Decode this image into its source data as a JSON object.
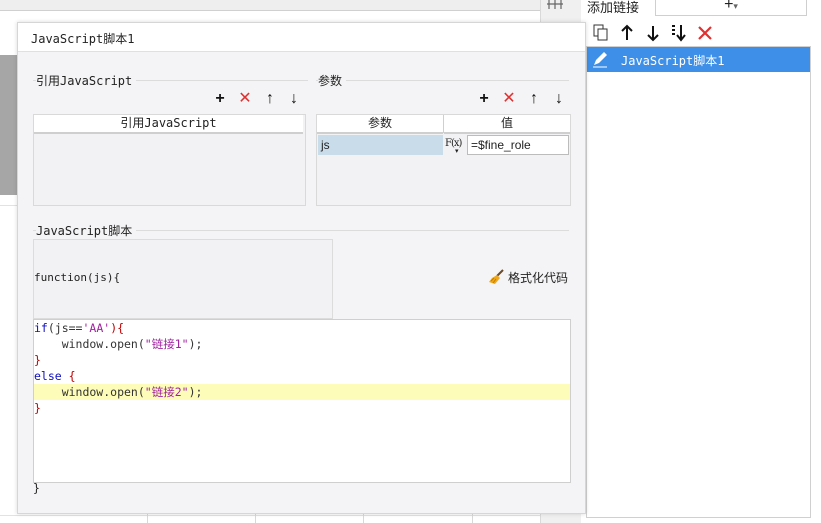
{
  "window": {
    "dialog_title": "JavaScript脚本1"
  },
  "link_panel": {
    "title": "添加链接",
    "add_symbol": "+",
    "add_dropdown_symbol": "▾",
    "toolbar": {
      "copy_icon": "copy-icon",
      "up_icon": "arrow-up-icon",
      "down_icon": "arrow-down-icon",
      "sort_icon": "sort-down-icon",
      "delete_icon": "delete-icon"
    },
    "items": [
      {
        "label": "JavaScript脚本1",
        "selected": true,
        "icon": "pencil-icon"
      }
    ],
    "selected_color": "#3d8fe8"
  },
  "js_refs": {
    "section_label": "引用JavaScript",
    "column_header": "引用JavaScript",
    "rows": []
  },
  "params": {
    "section_label": "参数",
    "columns": [
      "参数",
      "值"
    ],
    "rows": [
      {
        "name": "js",
        "fx_label": "F(x)",
        "value": "=$fine_role"
      }
    ]
  },
  "script": {
    "section_label": "JavaScript脚本",
    "function_signature": "function(js){",
    "format_button_label": "格式化代码",
    "code_lines": [
      {
        "parts": [
          {
            "t": "if",
            "c": "kw"
          },
          {
            "t": "(js==",
            "c": "op"
          },
          {
            "t": "'AA'",
            "c": "str"
          },
          {
            "t": "){",
            "c": "br"
          }
        ],
        "highlight": false
      },
      {
        "parts": [
          {
            "t": "    window.open(",
            "c": "op"
          },
          {
            "t": "\"链接1\"",
            "c": "str"
          },
          {
            "t": ");",
            "c": "op"
          }
        ],
        "highlight": false
      },
      {
        "parts": [
          {
            "t": "}",
            "c": "br"
          }
        ],
        "highlight": false
      },
      {
        "parts": [
          {
            "t": "else",
            "c": "kw"
          },
          {
            "t": " {",
            "c": "br"
          }
        ],
        "highlight": false
      },
      {
        "parts": [
          {
            "t": "    window.open(",
            "c": "op"
          },
          {
            "t": "\"链接2\"",
            "c": "str"
          },
          {
            "t": ");",
            "c": "op"
          }
        ],
        "highlight": true
      },
      {
        "parts": [
          {
            "t": "}",
            "c": "br"
          }
        ],
        "highlight": false
      }
    ],
    "closing_brace": "}"
  },
  "toolbar_symbols": {
    "add": "+",
    "delete": "✕",
    "up": "↑",
    "down": "↓"
  },
  "colors": {
    "delete_red": "#e03030",
    "keyword_blue": "#1010c0",
    "brace_red": "#c00000",
    "string_purple": "#a020a0",
    "highlight_yellow": "#fefcb9",
    "param_cell_blue": "#c9dcea"
  }
}
